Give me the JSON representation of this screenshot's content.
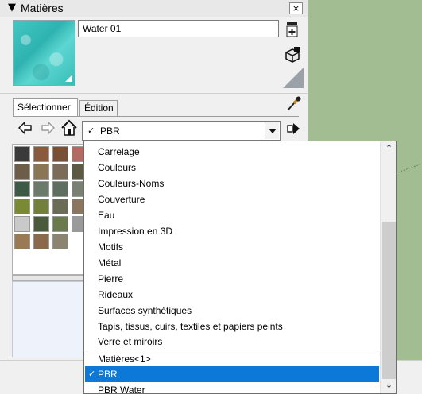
{
  "panel": {
    "title": "Matières",
    "collapse_glyph": "▼",
    "close_glyph": "×",
    "material_name": "Water 01",
    "tabs": [
      {
        "label": "Sélectionner",
        "active": true
      },
      {
        "label": "Édition",
        "active": false
      }
    ],
    "library": {
      "selected": "PBR",
      "check": "✓"
    },
    "preview_color": "#3fc2bf"
  },
  "swatch_colors": [
    [
      "#3a3a3a",
      "#8a5a3c",
      "#7a5034",
      "#b36a62"
    ],
    [
      "#6b5d48",
      "#8a7555",
      "#7a6c58",
      "#5d5a44"
    ],
    [
      "#3c5a46",
      "#6b7a6b",
      "#5e6f62",
      "#7a7f74"
    ],
    [
      "#7a8a34",
      "#72803c",
      "#6a6c56",
      "#8b7660"
    ],
    [
      "#c9c9c9",
      "#4a5a3a",
      "#6a7a4a",
      "#9a9a9a"
    ],
    [
      "#9a7a54",
      "#8a6a4a",
      "#8a8470",
      ""
    ]
  ],
  "dropdown": {
    "items": [
      "Carrelage",
      "Couleurs",
      "Couleurs-Noms",
      "Couverture",
      "Eau",
      "Impression en 3D",
      "Motifs",
      "Métal",
      "Pierre",
      "Rideaux",
      "Surfaces synthétiques",
      "Tapis, tissus, cuirs, textiles et papiers peints",
      "Verre et miroirs"
    ],
    "collections": [
      {
        "label": "Matières<1>",
        "selected": false
      },
      {
        "label": "PBR",
        "selected": true
      },
      {
        "label": "PBR Water",
        "selected": false
      }
    ],
    "check": "✓",
    "scroll_up": "⌃",
    "scroll_down": "⌄"
  },
  "colors": {
    "selection": "#0c78d8",
    "scene_background": "#a3bd92"
  }
}
